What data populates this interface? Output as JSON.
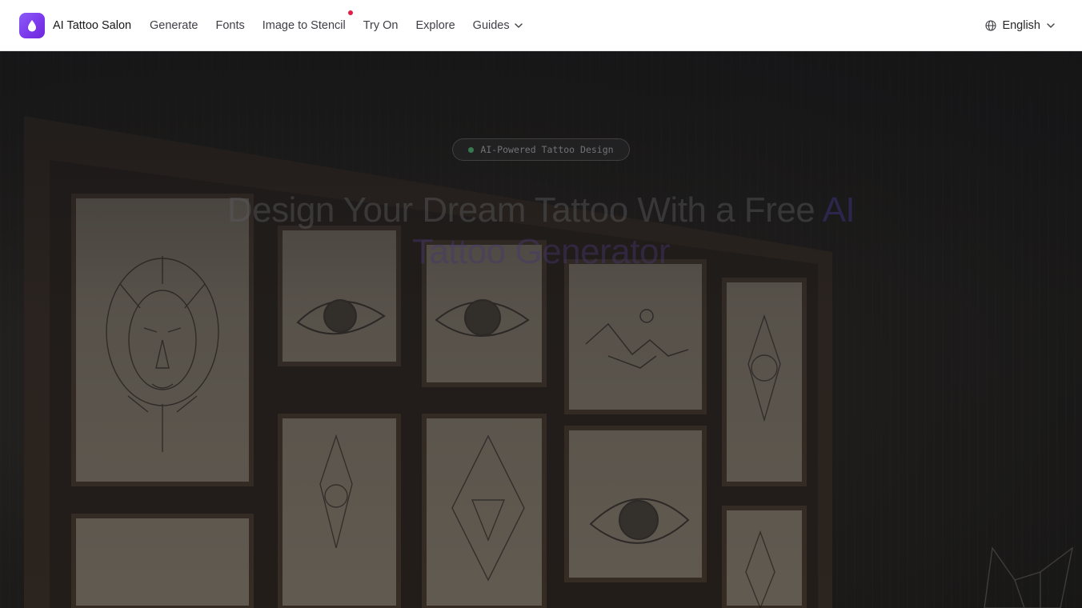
{
  "header": {
    "brand": "AI Tattoo Salon",
    "logo_icon": "droplet-icon",
    "nav": [
      {
        "label": "Generate"
      },
      {
        "label": "Fonts"
      },
      {
        "label": "Image to Stencil",
        "has_dot": true
      },
      {
        "label": "Try On"
      },
      {
        "label": "Explore"
      },
      {
        "label": "Guides",
        "dropdown": true
      }
    ],
    "language": "English"
  },
  "hero": {
    "badge": "AI-Powered Tattoo Design",
    "headline_main": "Design Your Dream Tattoo With a Free",
    "headline_accent": "AI",
    "headline_line2": "Tattoo Generator"
  },
  "colors": {
    "brand_purple": "#7c3aed",
    "notification_dot": "#e11d48",
    "badge_dot": "#3f8f5e"
  }
}
